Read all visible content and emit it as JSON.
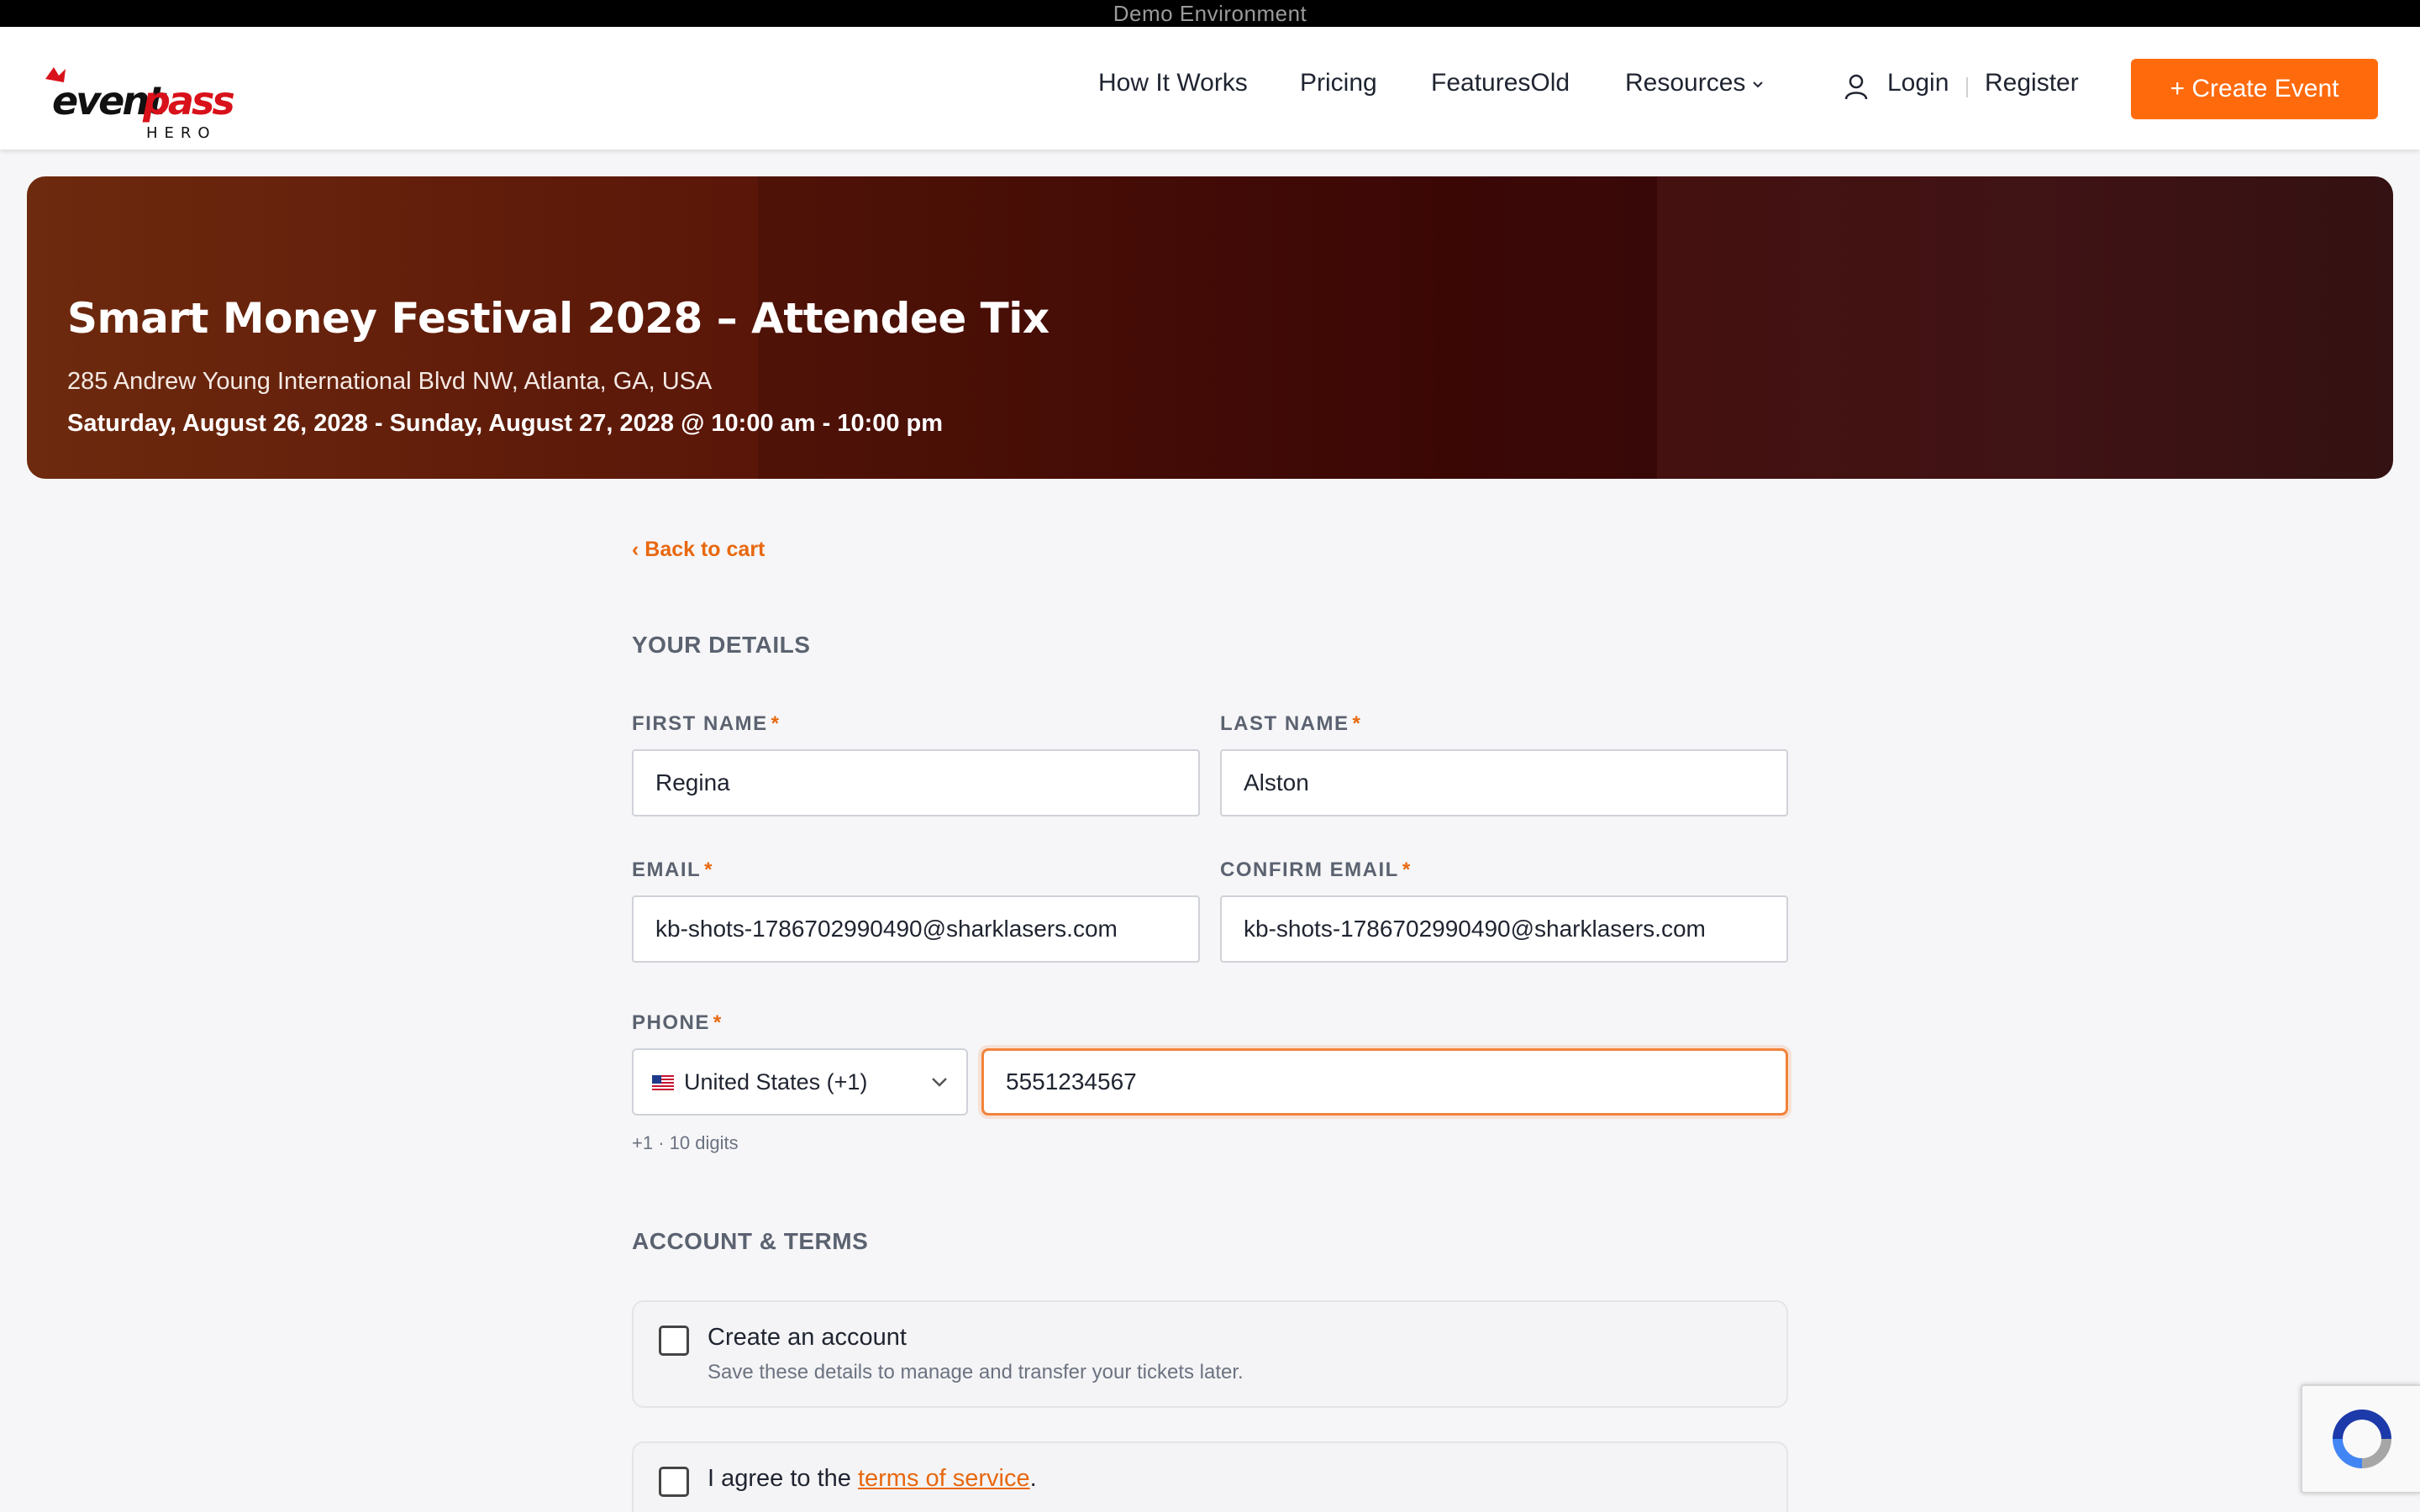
{
  "demo_banner": "Demo Environment",
  "header": {
    "logo_text": "eventpass",
    "logo_sub": "HERO",
    "nav": [
      "How It Works",
      "Pricing",
      "FeaturesOld",
      "Resources"
    ],
    "login": "Login",
    "register": "Register",
    "create_event": "+ Create Event",
    "accent": "#ff6a0d"
  },
  "hero": {
    "title": "Smart Money Festival 2028 – Attendee Tix",
    "address": "285 Andrew Young International Blvd NW, Atlanta, GA, USA",
    "dates": "Saturday, August 26, 2028 - Sunday, August 27, 2028 @ 10:00 am - 10:00 pm"
  },
  "form": {
    "back_link": "‹ Back to cart",
    "your_details_title": "YOUR DETAILS",
    "first_name": {
      "label": "FIRST NAME",
      "value": "Regina"
    },
    "last_name": {
      "label": "LAST NAME",
      "value": "Alston"
    },
    "email": {
      "label": "EMAIL",
      "value": "kb-shots-1786702990490@sharklasers.com"
    },
    "confirm_email": {
      "label": "CONFIRM EMAIL",
      "value": "kb-shots-1786702990490@sharklasers.com"
    },
    "phone": {
      "label": "PHONE",
      "country": "United States (+1)",
      "value": "5551234567",
      "hint": "+1 · 10 digits"
    },
    "account_terms_title": "ACCOUNT & TERMS",
    "create_account": {
      "title": "Create an account",
      "subtitle": "Save these details to manage and transfer your tickets later."
    },
    "terms": {
      "prefix": "I agree to the ",
      "link": "terms of service",
      "suffix": "."
    }
  }
}
